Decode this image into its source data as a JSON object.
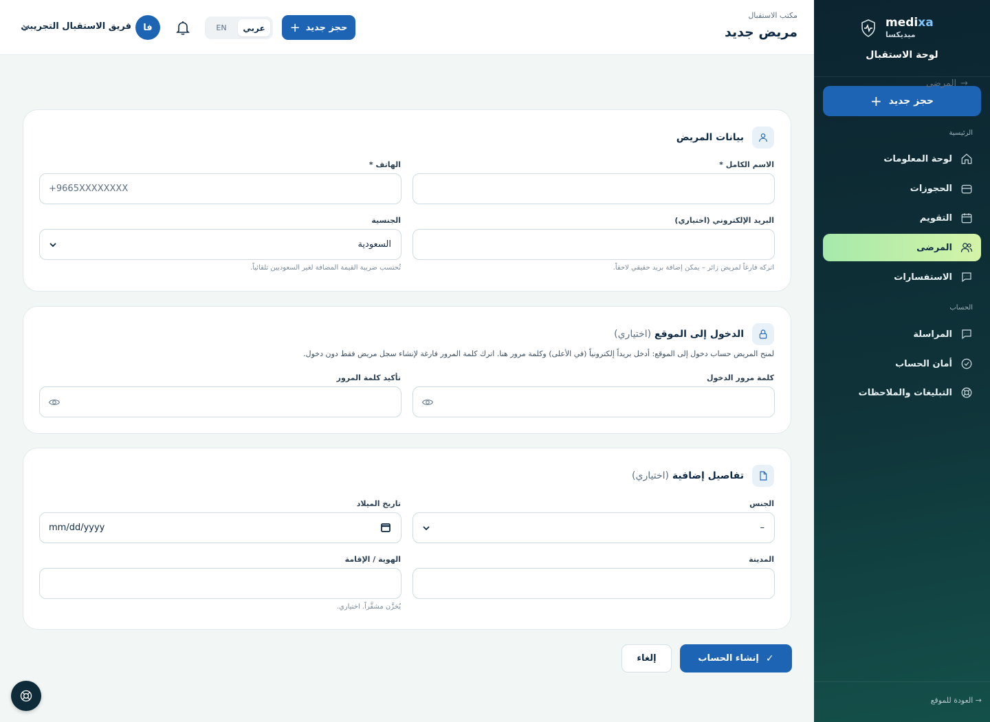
{
  "brand": {
    "name_en_main": "medi",
    "name_en_accent": "xa",
    "name_ar": "ميديكسا",
    "subtitle": "لوحة الاستقبال"
  },
  "sidebar": {
    "book_button": "حجز جديد",
    "section_main": "الرئيسية",
    "section_account": "الحساب",
    "items": [
      {
        "label": "لوحة المعلومات",
        "icon": "home-icon"
      },
      {
        "label": "الحجوزات",
        "icon": "briefcase-icon"
      },
      {
        "label": "التقويم",
        "icon": "calendar-icon"
      },
      {
        "label": "المرضى",
        "icon": "users-icon",
        "active": true
      },
      {
        "label": "الاستفسارات",
        "icon": "chat-icon"
      },
      {
        "label": "المراسلة",
        "icon": "message-icon"
      },
      {
        "label": "أمان الحساب",
        "icon": "check-circle-icon"
      },
      {
        "label": "التبليغات والملاحظات",
        "icon": "lifebuoy-icon"
      }
    ],
    "back_to_site": "العودة للموقع"
  },
  "header": {
    "crumb": "مكتب الاستقبال",
    "title": "مريض جديد",
    "book_button": "حجز جديد",
    "lang_ar": "عربي",
    "lang_en": "EN",
    "avatar_initials": "فا",
    "user_name": "فريق الاستقبال التجريبي"
  },
  "back_link": "المرضى",
  "patient_card": {
    "title": "بيانات المريض",
    "full_name_label": "الاسم الكامل *",
    "full_name_value": "",
    "phone_label": "الهاتف *",
    "phone_placeholder": "+9665XXXXXXXX",
    "email_label": "البريد الإلكتروني (اختياري)",
    "email_value": "",
    "email_hint": "اتركه فارغاً لمريض زائر – يمكن إضافة بريد حقيقي لاحقاً.",
    "nationality_label": "الجنسية",
    "nationality_value": "السعودية",
    "nationality_hint": "تُحتسب ضريبة القيمة المضافة لغير السعوديين تلقائياً."
  },
  "login_card": {
    "title": "الدخول إلى الموقع",
    "optional": "(اختياري)",
    "description": "لمنح المريض حساب دخول إلى الموقع: أدخل بريداً إلكترونياً (في الأعلى) وكلمة مرور هنا. اترك كلمة المرور فارغة لإنشاء سجل مريض فقط دون دخول.",
    "password_label": "كلمة مرور الدخول",
    "confirm_label": "تأكيد كلمة المرور"
  },
  "extra_card": {
    "title": "تفاصيل إضافية",
    "optional": "(اختياري)",
    "gender_label": "الجنس",
    "gender_value": "–",
    "dob_label": "تاريخ الميلاد",
    "dob_placeholder": "mm/dd/yyyy",
    "city_label": "المدينة",
    "id_label": "الهوية / الإقامة",
    "id_hint": "يُخزَّن مشفَّراً. اختياري."
  },
  "actions": {
    "create": "إنشاء الحساب",
    "cancel": "إلغاء"
  },
  "colors": {
    "primary": "#1d64b4",
    "sidebar_dark": "#0c2430",
    "active_green": "#a6e9aa"
  }
}
